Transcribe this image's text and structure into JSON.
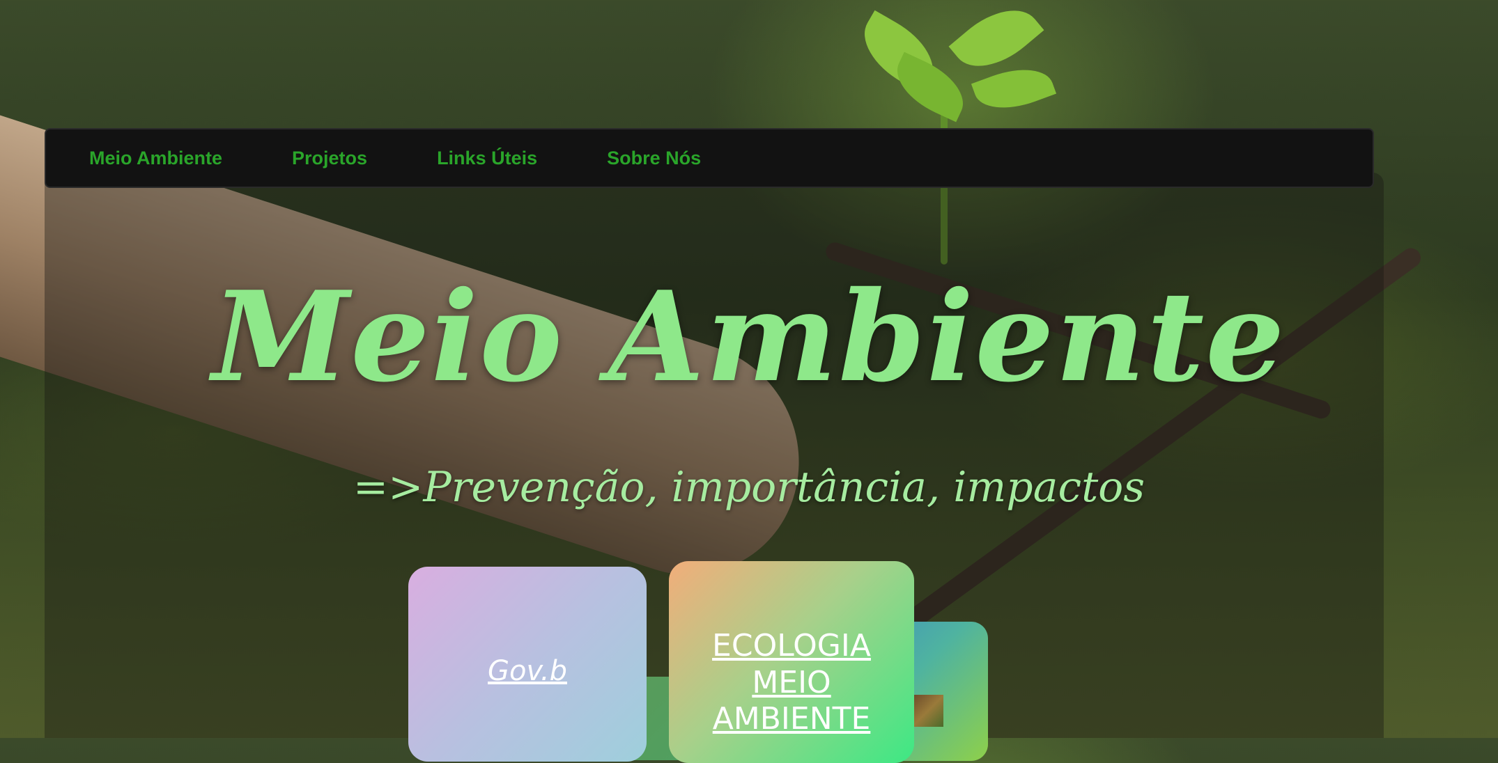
{
  "navbar": {
    "items": [
      {
        "label": "Meio Ambiente"
      },
      {
        "label": "Projetos"
      },
      {
        "label": "Links Úteis"
      },
      {
        "label": "Sobre Nós"
      }
    ],
    "link_color": "#2aa52a",
    "background": "#121212"
  },
  "hero": {
    "title": "Meio Ambiente",
    "subtitle": "=>Prevenção, importância, impactos",
    "text_color": "#8ee88a"
  },
  "cards": {
    "gov": {
      "label": "Gov.b"
    },
    "eco": {
      "label": "ECOLOGIA MEIO AMBIENTE"
    }
  }
}
